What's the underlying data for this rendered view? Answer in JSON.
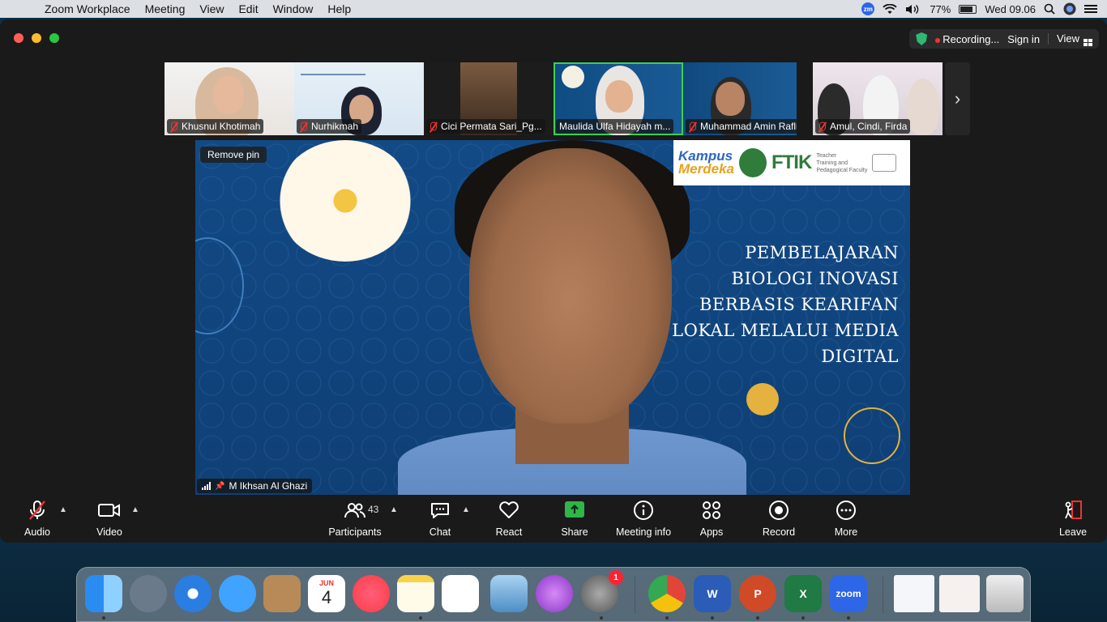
{
  "menubar": {
    "app_name": "Zoom Workplace",
    "items": [
      "Meeting",
      "View",
      "Edit",
      "Window",
      "Help"
    ],
    "battery": "77%",
    "clock": "Wed 09.06",
    "zm_badge": "zm"
  },
  "titlebar": {
    "recording": "Recording...",
    "sign_in": "Sign in",
    "view": "View"
  },
  "thumbnails": [
    {
      "name": "Khusnul Khotimah"
    },
    {
      "name": "Nurhikmah"
    },
    {
      "name": "Cici Permata Sari_Pg..."
    },
    {
      "name": "Maulida Ulfa Hidayah m...",
      "active": true
    },
    {
      "name": "Muhammad Amin Rafli"
    },
    {
      "name": "Amul, Cindi, Firda"
    }
  ],
  "main_video": {
    "remove_pin": "Remove pin",
    "speaker": "M Ikhsan Al Ghazi",
    "slide": {
      "logo_km_1": "Kampus",
      "logo_km_2": "Merdeka",
      "logo_ftik": "FTIK",
      "logo_ftik_sub_1": "Teacher",
      "logo_ftik_sub_2": "Training and",
      "logo_ftik_sub_3": "Pedagogical Faculty",
      "title_lines": [
        "PEMBELAJARAN",
        "BIOLOGI INOVASI",
        "BERBASIS KEARIFAN",
        "LOKAL MELALUI MEDIA",
        "DIGITAL"
      ]
    }
  },
  "toolbar": {
    "audio": "Audio",
    "video": "Video",
    "participants": "Participants",
    "participants_count": "43",
    "chat": "Chat",
    "react": "React",
    "share": "Share",
    "meeting_info": "Meeting info",
    "apps": "Apps",
    "record": "Record",
    "more": "More",
    "leave": "Leave"
  },
  "dock": {
    "calendar_month": "JUN",
    "calendar_day": "4",
    "settings_badge": "1",
    "zoom_label": "zoom",
    "word_label": "W",
    "ppt_label": "P",
    "excel_label": "X",
    "icons": [
      "finder-icon",
      "launchpad-icon",
      "safari-icon",
      "messages-icon",
      "contacts-icon",
      "calendar-icon",
      "music-icon",
      "notes-icon",
      "reminders-icon",
      "preview-icon",
      "podcasts-icon",
      "system-settings-icon",
      "chrome-icon",
      "word-icon",
      "powerpoint-icon",
      "excel-icon",
      "zoom-icon",
      "window-thumb-1",
      "window-thumb-2",
      "trash-icon"
    ]
  }
}
